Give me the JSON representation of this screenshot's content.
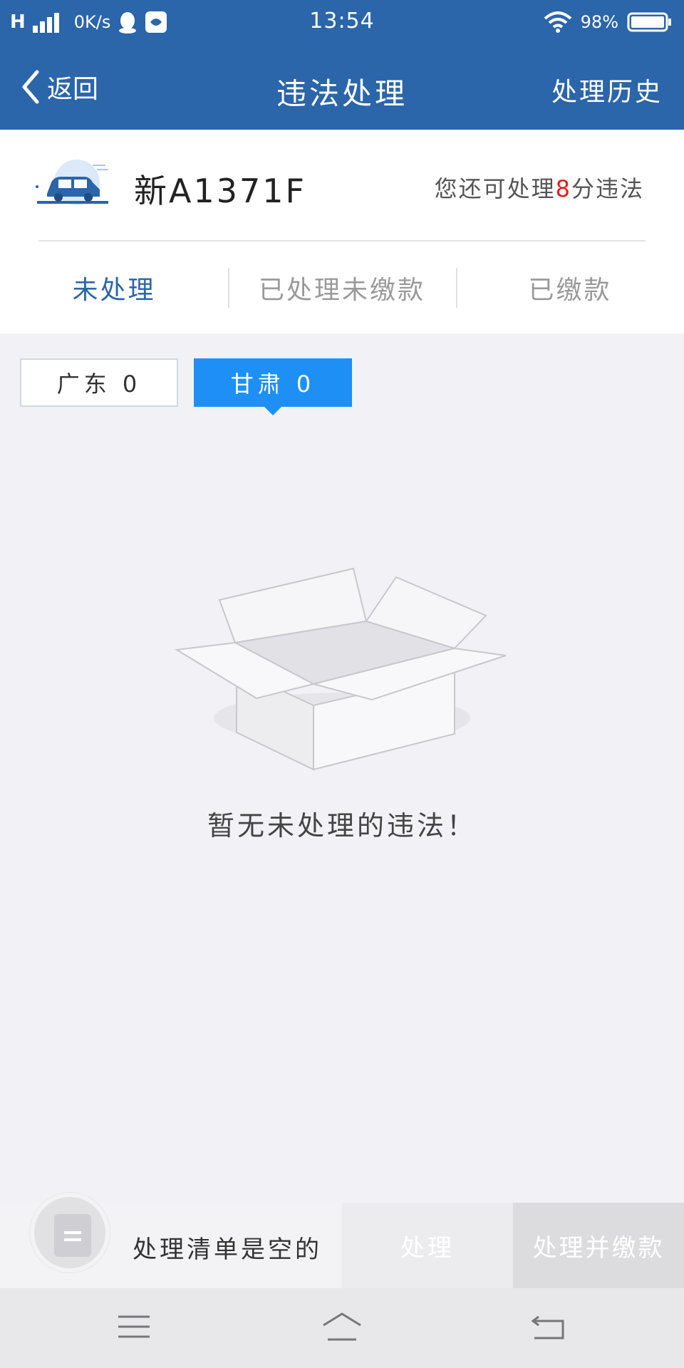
{
  "status_bar": {
    "signal": "H",
    "network_speed": "0K/s",
    "time": "13:54",
    "battery": "98%"
  },
  "header": {
    "back_label": "返回",
    "title": "违法处理",
    "history_label": "处理历史"
  },
  "vehicle": {
    "plate": "新A1371F",
    "points_prefix": "您还可处理",
    "points_value": "8",
    "points_suffix": "分违法"
  },
  "tabs": [
    {
      "label": "未处理",
      "active": true
    },
    {
      "label": "已处理未缴款",
      "active": false
    },
    {
      "label": "已缴款",
      "active": false
    }
  ],
  "regions": [
    {
      "label": "广东 0",
      "selected": false
    },
    {
      "label": "甘肃 0",
      "selected": true
    }
  ],
  "empty_state": {
    "message": "暂无未处理的违法！"
  },
  "action_bar": {
    "cart_text": "处理清单是空的",
    "handle_label": "处理",
    "pay_label": "处理并缴款"
  },
  "colors": {
    "primary": "#2b65aa",
    "accent": "#1e90f5",
    "points_highlight": "#e02020"
  },
  "icons": [
    "back-chevron-icon",
    "car-icon",
    "empty-box-icon",
    "list-icon",
    "menu-icon",
    "home-icon",
    "back-icon"
  ]
}
